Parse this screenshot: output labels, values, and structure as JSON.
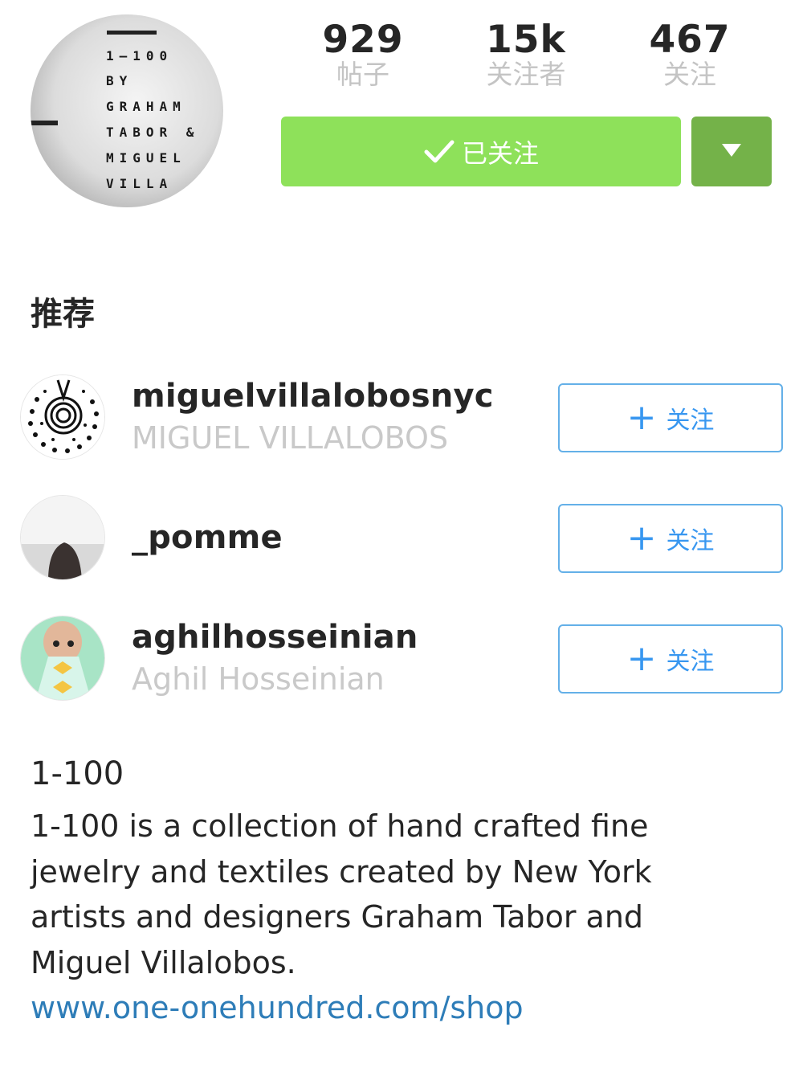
{
  "profile": {
    "avatar_text": "1-100 BY GRAHAM TABOR & MIGUEL VILLA",
    "stats": {
      "posts": {
        "value": "929",
        "label": "帖子"
      },
      "followers": {
        "value": "15k",
        "label": "关注者"
      },
      "following": {
        "value": "467",
        "label": "关注"
      }
    },
    "follow_button_label": "已关注",
    "icons": {
      "check": "check-icon",
      "dropdown": "caret-down-icon"
    }
  },
  "suggestions": {
    "title": "推荐",
    "follow_label": "关注",
    "items": [
      {
        "username": "miguelvillalobosnyc",
        "full_name": "MIGUEL VILLALOBOS"
      },
      {
        "username": "_pomme",
        "full_name": ""
      },
      {
        "username": "aghilhosseinian",
        "full_name": "Aghil Hosseinian"
      }
    ]
  },
  "bio": {
    "name": "1-100",
    "text": "1-100 is a collection of hand crafted fine jewelry and textiles created by New York artists and designers Graham Tabor and Miguel Villalobos.",
    "link": "www.one-onehundred.com/shop"
  },
  "colors": {
    "following_green": "#8ee15a",
    "dropdown_green": "#74b249",
    "follow_blue": "#3897f0",
    "link_blue": "#2e7db8",
    "muted_text": "#c4c4c4"
  }
}
